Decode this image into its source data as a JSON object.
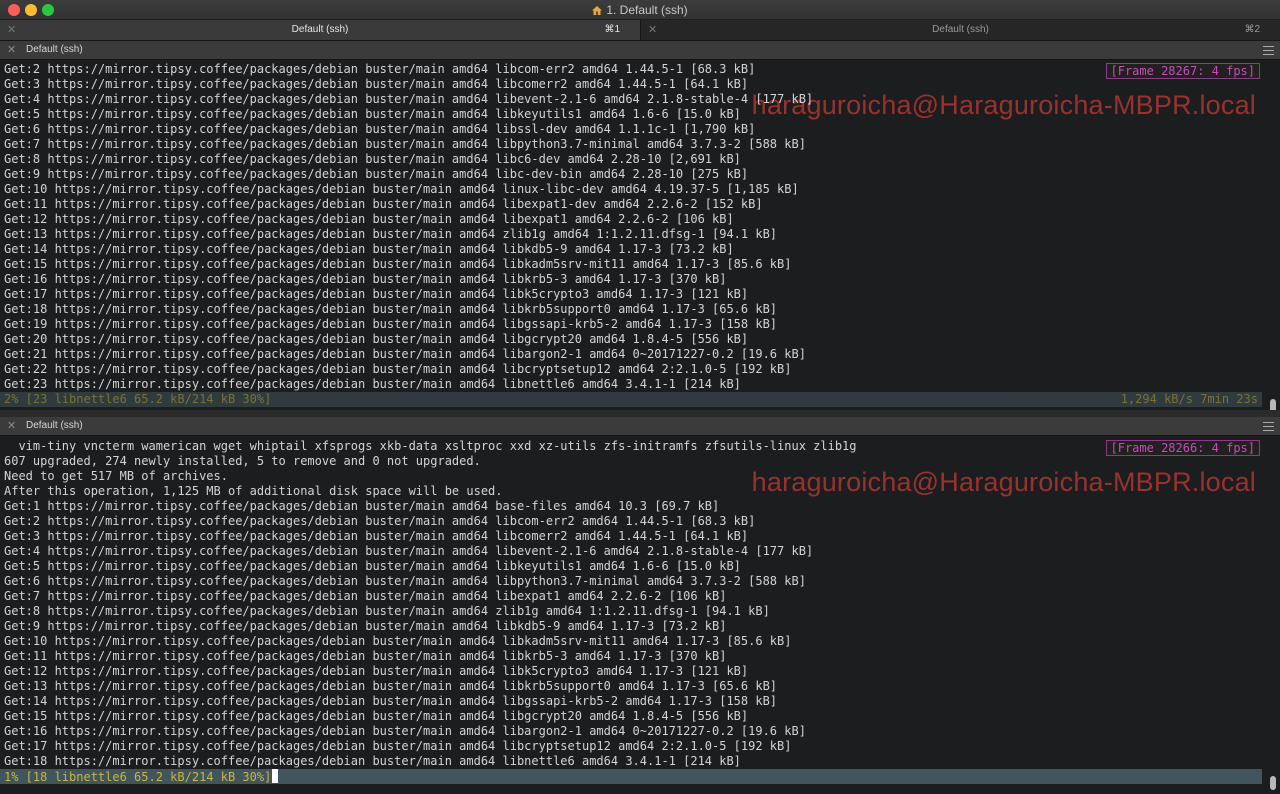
{
  "window": {
    "title": "1. Default (ssh)"
  },
  "tabs": [
    {
      "label": "Default (ssh)",
      "shortcut": "⌘1"
    },
    {
      "label": "Default (ssh)",
      "shortcut": "⌘2"
    }
  ],
  "top_pane": {
    "header": "Default (ssh)",
    "frame_badge": "[Frame 28267: 4 fps]",
    "watermark": "haraguroicha@Haraguroicha-MBPR.local",
    "lines": [
      "Get:2 https://mirror.tipsy.coffee/packages/debian buster/main amd64 libcom-err2 amd64 1.44.5-1 [68.3 kB]",
      "Get:3 https://mirror.tipsy.coffee/packages/debian buster/main amd64 libcomerr2 amd64 1.44.5-1 [64.1 kB]",
      "Get:4 https://mirror.tipsy.coffee/packages/debian buster/main amd64 libevent-2.1-6 amd64 2.1.8-stable-4 [177 kB]",
      "Get:5 https://mirror.tipsy.coffee/packages/debian buster/main amd64 libkeyutils1 amd64 1.6-6 [15.0 kB]",
      "Get:6 https://mirror.tipsy.coffee/packages/debian buster/main amd64 libssl-dev amd64 1.1.1c-1 [1,790 kB]",
      "Get:7 https://mirror.tipsy.coffee/packages/debian buster/main amd64 libpython3.7-minimal amd64 3.7.3-2 [588 kB]",
      "Get:8 https://mirror.tipsy.coffee/packages/debian buster/main amd64 libc6-dev amd64 2.28-10 [2,691 kB]",
      "Get:9 https://mirror.tipsy.coffee/packages/debian buster/main amd64 libc-dev-bin amd64 2.28-10 [275 kB]",
      "Get:10 https://mirror.tipsy.coffee/packages/debian buster/main amd64 linux-libc-dev amd64 4.19.37-5 [1,185 kB]",
      "Get:11 https://mirror.tipsy.coffee/packages/debian buster/main amd64 libexpat1-dev amd64 2.2.6-2 [152 kB]",
      "Get:12 https://mirror.tipsy.coffee/packages/debian buster/main amd64 libexpat1 amd64 2.2.6-2 [106 kB]",
      "Get:13 https://mirror.tipsy.coffee/packages/debian buster/main amd64 zlib1g amd64 1:1.2.11.dfsg-1 [94.1 kB]",
      "Get:14 https://mirror.tipsy.coffee/packages/debian buster/main amd64 libkdb5-9 amd64 1.17-3 [73.2 kB]",
      "Get:15 https://mirror.tipsy.coffee/packages/debian buster/main amd64 libkadm5srv-mit11 amd64 1.17-3 [85.6 kB]",
      "Get:16 https://mirror.tipsy.coffee/packages/debian buster/main amd64 libkrb5-3 amd64 1.17-3 [370 kB]",
      "Get:17 https://mirror.tipsy.coffee/packages/debian buster/main amd64 libk5crypto3 amd64 1.17-3 [121 kB]",
      "Get:18 https://mirror.tipsy.coffee/packages/debian buster/main amd64 libkrb5support0 amd64 1.17-3 [65.6 kB]",
      "Get:19 https://mirror.tipsy.coffee/packages/debian buster/main amd64 libgssapi-krb5-2 amd64 1.17-3 [158 kB]",
      "Get:20 https://mirror.tipsy.coffee/packages/debian buster/main amd64 libgcrypt20 amd64 1.8.4-5 [556 kB]",
      "Get:21 https://mirror.tipsy.coffee/packages/debian buster/main amd64 libargon2-1 amd64 0~20171227-0.2 [19.6 kB]",
      "Get:22 https://mirror.tipsy.coffee/packages/debian buster/main amd64 libcryptsetup12 amd64 2:2.1.0-5 [192 kB]",
      "Get:23 https://mirror.tipsy.coffee/packages/debian buster/main amd64 libnettle6 amd64 3.4.1-1 [214 kB]"
    ],
    "status_left": "2% [23 libnettle6 65.2 kB/214 kB 30%]",
    "status_right": "1,294 kB/s 7min 23s"
  },
  "bottom_pane": {
    "header": "Default (ssh)",
    "frame_badge": "[Frame 28266: 4 fps]",
    "watermark": "haraguroicha@Haraguroicha-MBPR.local",
    "lines": [
      "  vim-tiny vncterm wamerican wget whiptail xfsprogs xkb-data xsltproc xxd xz-utils zfs-initramfs zfsutils-linux zlib1g",
      "607 upgraded, 274 newly installed, 5 to remove and 0 not upgraded.",
      "Need to get 517 MB of archives.",
      "After this operation, 1,125 MB of additional disk space will be used.",
      "Get:1 https://mirror.tipsy.coffee/packages/debian buster/main amd64 base-files amd64 10.3 [69.7 kB]",
      "Get:2 https://mirror.tipsy.coffee/packages/debian buster/main amd64 libcom-err2 amd64 1.44.5-1 [68.3 kB]",
      "Get:3 https://mirror.tipsy.coffee/packages/debian buster/main amd64 libcomerr2 amd64 1.44.5-1 [64.1 kB]",
      "Get:4 https://mirror.tipsy.coffee/packages/debian buster/main amd64 libevent-2.1-6 amd64 2.1.8-stable-4 [177 kB]",
      "Get:5 https://mirror.tipsy.coffee/packages/debian buster/main amd64 libkeyutils1 amd64 1.6-6 [15.0 kB]",
      "Get:6 https://mirror.tipsy.coffee/packages/debian buster/main amd64 libpython3.7-minimal amd64 3.7.3-2 [588 kB]",
      "Get:7 https://mirror.tipsy.coffee/packages/debian buster/main amd64 libexpat1 amd64 2.2.6-2 [106 kB]",
      "Get:8 https://mirror.tipsy.coffee/packages/debian buster/main amd64 zlib1g amd64 1:1.2.11.dfsg-1 [94.1 kB]",
      "Get:9 https://mirror.tipsy.coffee/packages/debian buster/main amd64 libkdb5-9 amd64 1.17-3 [73.2 kB]",
      "Get:10 https://mirror.tipsy.coffee/packages/debian buster/main amd64 libkadm5srv-mit11 amd64 1.17-3 [85.6 kB]",
      "Get:11 https://mirror.tipsy.coffee/packages/debian buster/main amd64 libkrb5-3 amd64 1.17-3 [370 kB]",
      "Get:12 https://mirror.tipsy.coffee/packages/debian buster/main amd64 libk5crypto3 amd64 1.17-3 [121 kB]",
      "Get:13 https://mirror.tipsy.coffee/packages/debian buster/main amd64 libkrb5support0 amd64 1.17-3 [65.6 kB]",
      "Get:14 https://mirror.tipsy.coffee/packages/debian buster/main amd64 libgssapi-krb5-2 amd64 1.17-3 [158 kB]",
      "Get:15 https://mirror.tipsy.coffee/packages/debian buster/main amd64 libgcrypt20 amd64 1.8.4-5 [556 kB]",
      "Get:16 https://mirror.tipsy.coffee/packages/debian buster/main amd64 libargon2-1 amd64 0~20171227-0.2 [19.6 kB]",
      "Get:17 https://mirror.tipsy.coffee/packages/debian buster/main amd64 libcryptsetup12 amd64 2:2.1.0-5 [192 kB]",
      "Get:18 https://mirror.tipsy.coffee/packages/debian buster/main amd64 libnettle6 amd64 3.4.1-1 [214 kB]"
    ],
    "status_left": "1% [18 libnettle6 65.2 kB/214 kB 30%]"
  },
  "colors": {
    "background": "#1b1d1f",
    "text": "#d4d4d4",
    "status_bar": "#42545c",
    "status_text": "#c7b745",
    "frame_badge": "#c24fb9",
    "watermark": "#c43834"
  }
}
